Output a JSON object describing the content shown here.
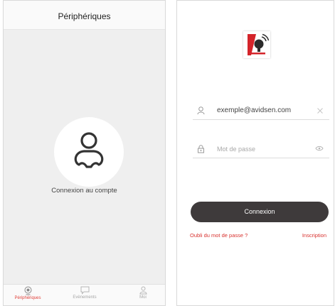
{
  "left": {
    "title": "Périphériques",
    "connect_label": "Connexion au compte",
    "tabs": [
      {
        "label": "Périphériques",
        "icon": "camera-icon",
        "active": true
      },
      {
        "label": "Evènements",
        "icon": "message-icon",
        "active": false
      },
      {
        "label": "Moi",
        "icon": "user-icon",
        "active": false
      }
    ]
  },
  "right": {
    "email": {
      "value": "exemple@avidsen.com",
      "icon": "user-icon",
      "clear_icon": "close-icon"
    },
    "password": {
      "placeholder": "Mot de passe",
      "icon": "lock-icon",
      "toggle_icon": "eye-icon"
    },
    "login_label": "Connexion",
    "forgot_label": "Oubli du mot de passe ?",
    "signup_label": "Inscription"
  },
  "colors": {
    "accent": "#e0403a",
    "button": "#3e3a3b",
    "left_background": "#efefef"
  }
}
